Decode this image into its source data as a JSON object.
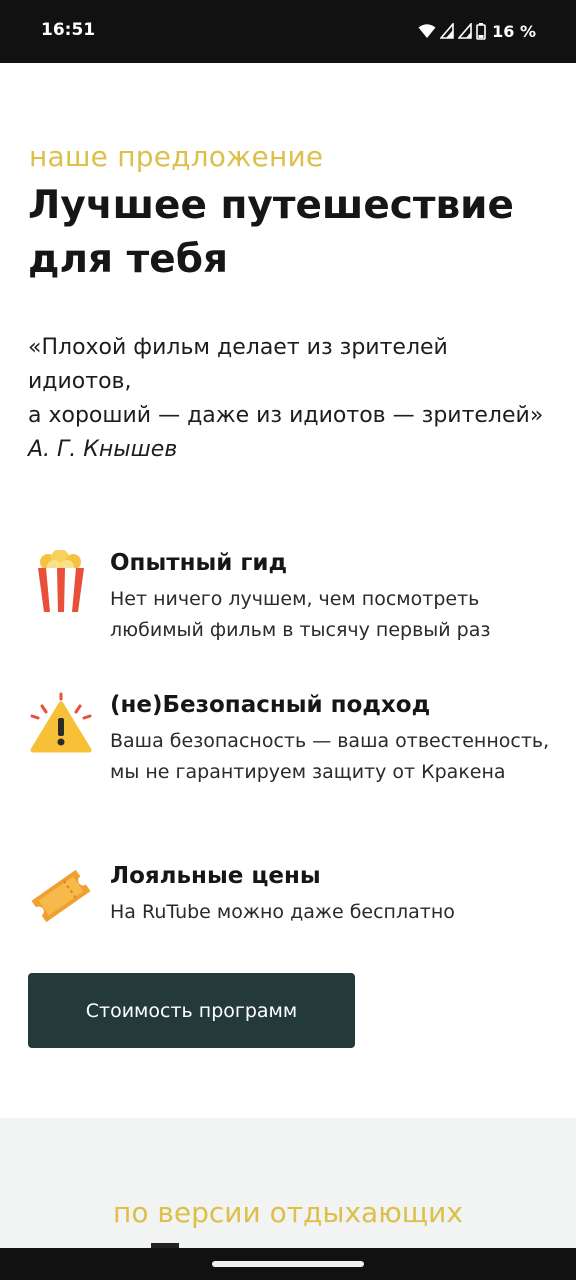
{
  "status_bar": {
    "time": "16:51",
    "battery": "16 %",
    "icons": [
      "wifi-icon",
      "signal-icon",
      "signal-icon",
      "battery-icon"
    ]
  },
  "hero": {
    "eyebrow": "наше предложение",
    "title": "Лучшее путешествие для тебя"
  },
  "quote": {
    "line1": "«Плохой фильм делает из зрителей идиотов,",
    "line2": "а хороший — даже из идиотов — зрителей»",
    "author": "А. Г. Кнышев"
  },
  "features": [
    {
      "icon": "popcorn-icon",
      "title": "Опытный гид",
      "text": "Нет ничего лучшем, чем посмотреть любимый фильм в тысячу первый раз"
    },
    {
      "icon": "warning-icon",
      "title": "(не)Безопасный подход",
      "text": "Ваша безопасность — ваша отвестенность, мы не гарантируем защиту от Кракена"
    },
    {
      "icon": "ticket-icon",
      "title": "Лояльные цены",
      "text": "На RuTube можно даже бесплатно"
    }
  ],
  "cta": {
    "label": "Стоимость программ"
  },
  "reviews": {
    "eyebrow": "по версии отдыхающих"
  },
  "colors": {
    "accent": "#dcc04a",
    "button": "#243a3a",
    "bars": "#111111",
    "section_bg": "#f2f3f3"
  }
}
